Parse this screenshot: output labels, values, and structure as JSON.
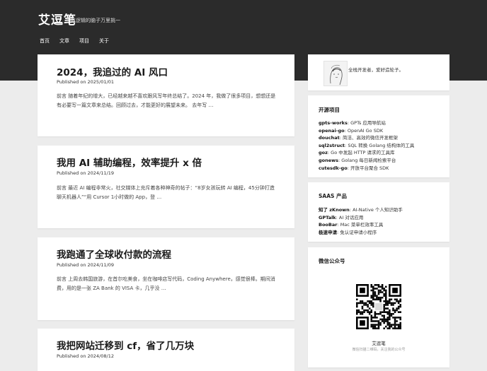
{
  "site": {
    "title": "艾逗笔",
    "tagline": "有逻辑的脑子万里挑一"
  },
  "nav": [
    "首页",
    "文章",
    "项目",
    "关于"
  ],
  "posts": [
    {
      "title": "2024，我追过的 AI 风口",
      "date": "Published on 2025/01/01",
      "excerpt": "前言 随着年纪的增大，已经越来越不喜欢跟风写年终总结了。2024 年，我做了很多项目，想想还是有必要写一篇文章来总结。回顾过去，才能更好的展望未来。 去年写 …"
    },
    {
      "title": "我用 AI 辅助编程，效率提升 x 倍",
      "date": "Published on 2024/11/19",
      "excerpt": "前言 最近 AI 编程非常火，社交媒体上充斥着各种神奇的帖子：“8岁女孩玩转 AI 编程，45分钟打造聊天机器人”“用 Cursor 1小时做的 App，登 …"
    },
    {
      "title": "我跑通了全球收付款的流程",
      "date": "Published on 2024/11/09",
      "excerpt": "前言 上周去韩国旅游，在首尔吃美食，坐在咖啡店写代码，Coding Anywhere，感觉很棒。期间消费，用的是一张 ZA Bank 的 VISA 卡，几乎没 …"
    },
    {
      "title": "我把网站迁移到 cf，省了几万块",
      "date": "Published on 2024/08/12",
      "excerpt": ""
    }
  ],
  "sidebar": {
    "about": {
      "text": "全栈开发者，爱好造轮子。"
    },
    "opensource": {
      "heading": "开源项目",
      "items": [
        {
          "name": "gpts-works",
          "desc": "GPTs 应用导航站"
        },
        {
          "name": "openai-go",
          "desc": "OpenAI Go SDK"
        },
        {
          "name": "douchat",
          "desc": "简洁、高效的微信开发框架"
        },
        {
          "name": "sql2struct",
          "desc": "SQL 转换 Golang 结构体的工具"
        },
        {
          "name": "goz",
          "desc": "Go 中发起 HTTP 请求的工具库"
        },
        {
          "name": "gonews",
          "desc": "Golang 每日新闻检索平台"
        },
        {
          "name": "cutesdk-go",
          "desc": "开放平台聚合 SDK"
        }
      ]
    },
    "saas": {
      "heading": "SAAS 产品",
      "items": [
        {
          "name": "知了 zKnown",
          "desc": "AI-Native 个人知识助手"
        },
        {
          "name": "GPTalk",
          "desc": "AI 对话应用"
        },
        {
          "name": "BooBar",
          "desc": "Mac 菜单栏效率工具"
        },
        {
          "name": "极速申请",
          "desc": "免认证申请小程序"
        }
      ]
    },
    "wechat": {
      "heading": "微信公众号",
      "name": "艾逗笔",
      "sub": "微信扫描二维码，关注我的公众号"
    }
  }
}
